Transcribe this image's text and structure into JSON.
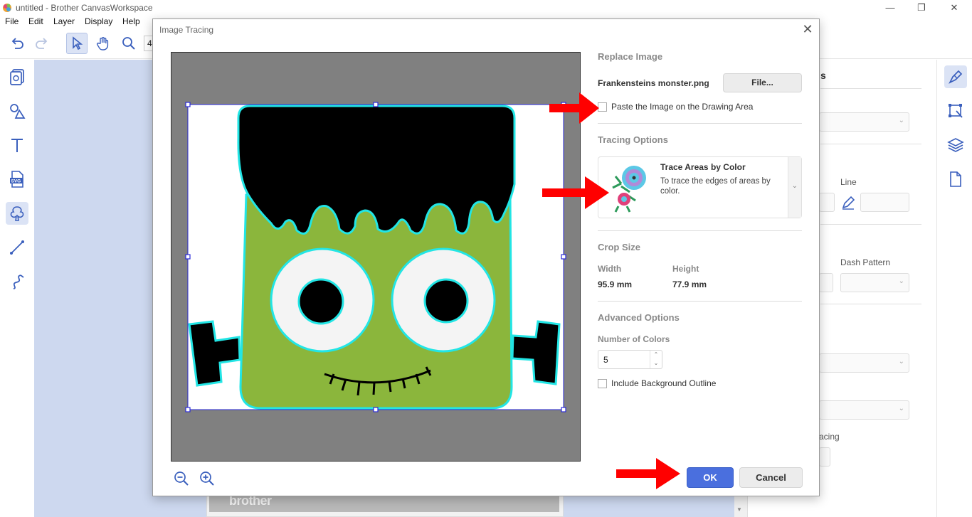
{
  "window": {
    "title": "untitled - Brother CanvasWorkspace",
    "controls": {
      "minimize": "—",
      "restore": "❐",
      "close": "✕"
    }
  },
  "menu": [
    "File",
    "Edit",
    "Layer",
    "Display",
    "Help"
  ],
  "toolbar": {
    "zoom_partial": "4",
    "tools": [
      "undo-icon",
      "redo-icon",
      "select-pointer-icon",
      "pan-hand-icon",
      "zoom-magnifier-icon"
    ]
  },
  "left_rail": [
    "page-icon",
    "shapes-icon",
    "text-icon",
    "svg-file-icon",
    "image-trace-icon",
    "line-icon",
    "freehand-icon"
  ],
  "canvas": {
    "brand_text": "brother"
  },
  "right_panel": {
    "partial_heading": "s",
    "line_label": "Line",
    "dash_pattern_label": "Dash Pattern",
    "spacing_partial": "acing"
  },
  "right_rail": [
    "paint-edit-icon",
    "transform-icon",
    "layers-icon",
    "page-setup-icon"
  ],
  "dialog": {
    "title": "Image Tracing",
    "close": "✕",
    "replace_image": {
      "heading": "Replace Image",
      "file_name": "Frankensteins monster.png",
      "file_button": "File...",
      "paste_label": "Paste the Image on the Drawing Area",
      "paste_checked": false
    },
    "tracing_options": {
      "heading": "Tracing Options",
      "mode_title": "Trace Areas by Color",
      "mode_desc": "To trace the edges of areas by color."
    },
    "crop_size": {
      "heading": "Crop Size",
      "width_label": "Width",
      "height_label": "Height",
      "width_value": "95.9 mm",
      "height_value": "77.9 mm"
    },
    "advanced": {
      "heading": "Advanced Options",
      "colors_label": "Number of Colors",
      "colors_value": "5",
      "bg_outline_label": "Include Background Outline",
      "bg_outline_checked": false
    },
    "ok": "OK",
    "cancel": "Cancel"
  },
  "colors": {
    "accent": "#4a6fde",
    "trace_outline": "#22e5e5",
    "monster_green": "#8bb63c",
    "annotation_arrow": "#ff0000",
    "preview_bg": "#808080"
  }
}
